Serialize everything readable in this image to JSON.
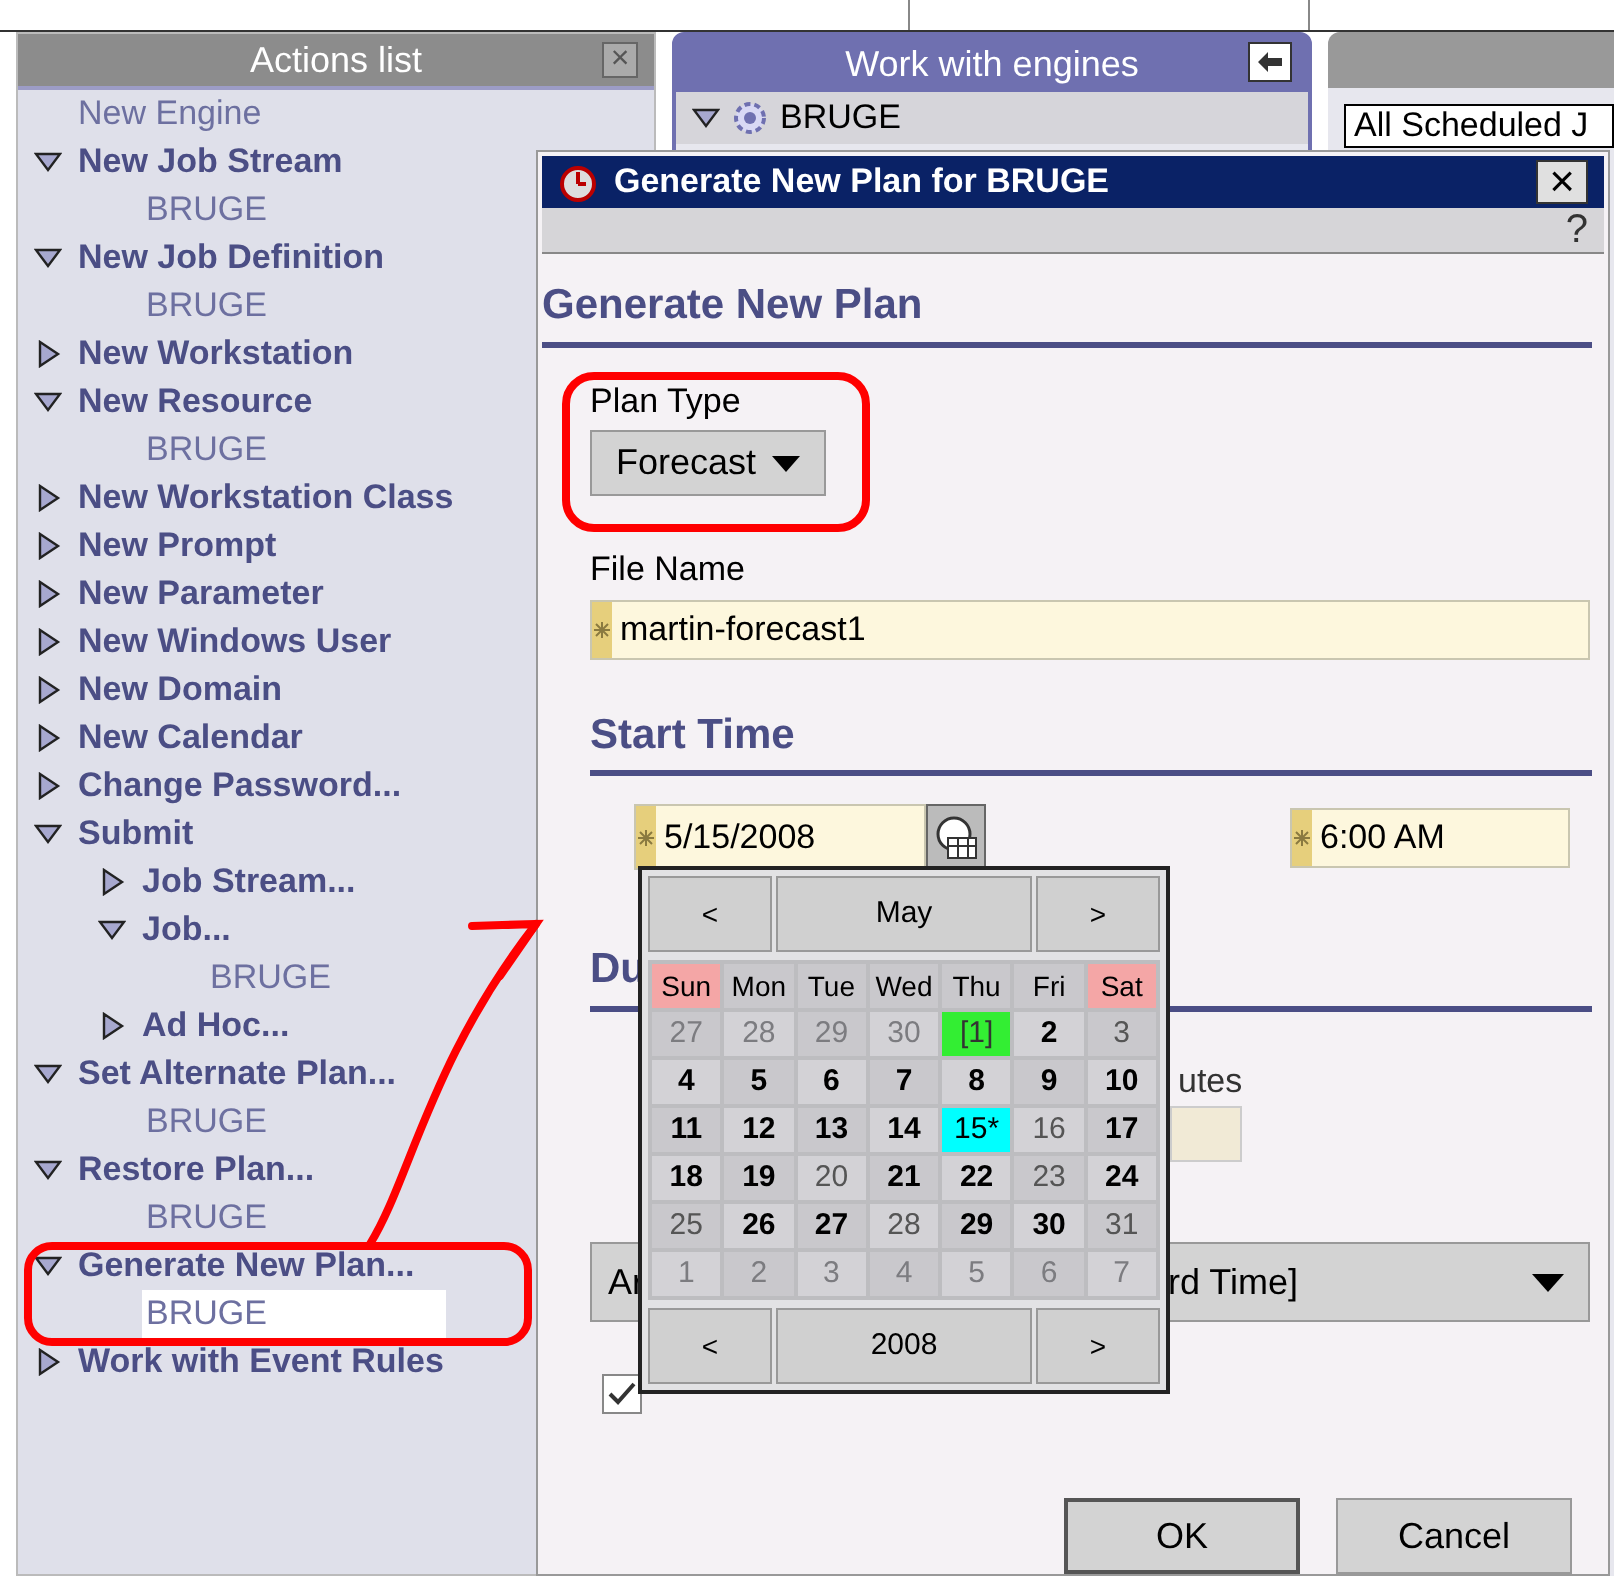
{
  "actions_panel": {
    "title": "Actions list",
    "close": "×",
    "items": [
      {
        "label": "New Engine"
      },
      {
        "label": "New Job Stream",
        "expanded": true,
        "children": [
          {
            "label": "BRUGE",
            "selected": false
          }
        ]
      },
      {
        "label": "New Job Definition",
        "expanded": true,
        "children": [
          {
            "label": "BRUGE",
            "selected": false
          }
        ]
      },
      {
        "label": "New Workstation",
        "expanded": false
      },
      {
        "label": "New Resource",
        "expanded": true,
        "children": [
          {
            "label": "BRUGE",
            "selected": false
          }
        ]
      },
      {
        "label": "New Workstation Class",
        "expanded": false
      },
      {
        "label": "New Prompt",
        "expanded": false
      },
      {
        "label": "New Parameter",
        "expanded": false
      },
      {
        "label": "New Windows User",
        "expanded": false
      },
      {
        "label": "New Domain",
        "expanded": false
      },
      {
        "label": "New Calendar",
        "expanded": false
      },
      {
        "label": "Change Password...",
        "expanded": false
      },
      {
        "label": "Submit",
        "expanded": true,
        "children": [
          {
            "label": "Job Stream...",
            "expanded": false
          },
          {
            "label": "Job...",
            "expanded": true,
            "children": [
              {
                "label": "BRUGE",
                "selected": false
              }
            ]
          },
          {
            "label": "Ad Hoc...",
            "expanded": false
          }
        ]
      },
      {
        "label": "Set Alternate Plan...",
        "expanded": true,
        "children": [
          {
            "label": "BRUGE",
            "selected": false
          }
        ]
      },
      {
        "label": "Restore Plan...",
        "expanded": true,
        "children": [
          {
            "label": "BRUGE",
            "selected": false
          }
        ]
      },
      {
        "label": "Generate New Plan...",
        "expanded": true,
        "children": [
          {
            "label": "BRUGE",
            "selected": true
          }
        ]
      },
      {
        "label": "Work with Event Rules",
        "expanded": false
      }
    ]
  },
  "engines_panel": {
    "title": "Work with engines",
    "engine": {
      "label": "BRUGE",
      "expanded": true
    }
  },
  "right_panel": {
    "filter": "All Scheduled J"
  },
  "dialog": {
    "title": "Generate New Plan for BRUGE",
    "close": "×",
    "help": "?",
    "heading": "Generate New Plan",
    "plan_type": {
      "label": "Plan Type",
      "value": "Forecast"
    },
    "file_name": {
      "label": "File Name",
      "value": "martin-forecast1"
    },
    "start_time": {
      "heading": "Start Time",
      "date": "5/15/2008",
      "time": "6:00 AM"
    },
    "duration": {
      "heading": "Du",
      "unit_label": "utes"
    },
    "time_zone": {
      "value_start": "Ar",
      "value_end": "rd Time]"
    },
    "checkbox": {
      "checked": true
    },
    "calendar": {
      "prev": "<",
      "next": ">",
      "month": "May",
      "year": "2008",
      "weekdays": [
        {
          "label": "Sun",
          "weekend": true
        },
        {
          "label": "Mon",
          "weekend": false
        },
        {
          "label": "Tue",
          "weekend": false
        },
        {
          "label": "Wed",
          "weekend": false
        },
        {
          "label": "Thu",
          "weekend": false
        },
        {
          "label": "Fri",
          "weekend": false
        },
        {
          "label": "Sat",
          "weekend": true
        }
      ],
      "days": [
        {
          "label": "27",
          "kind": "other"
        },
        {
          "label": "28",
          "kind": "other"
        },
        {
          "label": "29",
          "kind": "other"
        },
        {
          "label": "30",
          "kind": "other"
        },
        {
          "label": "[1]",
          "kind": "today"
        },
        {
          "label": "2",
          "kind": "normal"
        },
        {
          "label": "3",
          "kind": "muted"
        },
        {
          "label": "4",
          "kind": "normal"
        },
        {
          "label": "5",
          "kind": "normal"
        },
        {
          "label": "6",
          "kind": "normal"
        },
        {
          "label": "7",
          "kind": "normal"
        },
        {
          "label": "8",
          "kind": "normal"
        },
        {
          "label": "9",
          "kind": "normal"
        },
        {
          "label": "10",
          "kind": "normal"
        },
        {
          "label": "11",
          "kind": "normal"
        },
        {
          "label": "12",
          "kind": "normal"
        },
        {
          "label": "13",
          "kind": "normal"
        },
        {
          "label": "14",
          "kind": "normal"
        },
        {
          "label": "15*",
          "kind": "selected"
        },
        {
          "label": "16",
          "kind": "muted"
        },
        {
          "label": "17",
          "kind": "normal"
        },
        {
          "label": "18",
          "kind": "normal"
        },
        {
          "label": "19",
          "kind": "normal"
        },
        {
          "label": "20",
          "kind": "muted"
        },
        {
          "label": "21",
          "kind": "normal"
        },
        {
          "label": "22",
          "kind": "normal"
        },
        {
          "label": "23",
          "kind": "muted"
        },
        {
          "label": "24",
          "kind": "normal"
        },
        {
          "label": "25",
          "kind": "muted"
        },
        {
          "label": "26",
          "kind": "normal"
        },
        {
          "label": "27",
          "kind": "normal"
        },
        {
          "label": "28",
          "kind": "muted"
        },
        {
          "label": "29",
          "kind": "normal"
        },
        {
          "label": "30",
          "kind": "normal"
        },
        {
          "label": "31",
          "kind": "muted"
        },
        {
          "label": "1",
          "kind": "other"
        },
        {
          "label": "2",
          "kind": "other"
        },
        {
          "label": "3",
          "kind": "other"
        },
        {
          "label": "4",
          "kind": "other"
        },
        {
          "label": "5",
          "kind": "other"
        },
        {
          "label": "6",
          "kind": "other"
        },
        {
          "label": "7",
          "kind": "other"
        }
      ]
    },
    "buttons": [
      "OK",
      "Cancel"
    ]
  }
}
